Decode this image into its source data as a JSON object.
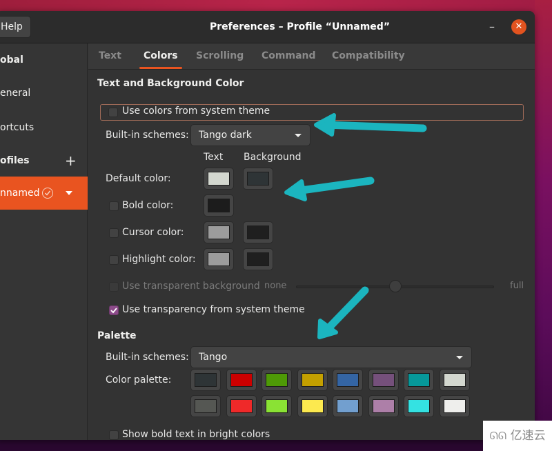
{
  "window": {
    "title": "Preferences – Profile “Unnamed”",
    "help_label": "Help",
    "minimize_glyph": "–",
    "close_glyph": "✕"
  },
  "sidebar": {
    "items": [
      {
        "label": "Global",
        "visible_text": "obal",
        "type": "header"
      },
      {
        "label": "General",
        "visible_text": "eneral",
        "type": "item"
      },
      {
        "label": "Shortcuts",
        "visible_text": "ortcuts",
        "type": "item"
      },
      {
        "label": "Profiles",
        "visible_text": "ofiles",
        "type": "header",
        "action_icon": "+"
      },
      {
        "label": "Unnamed",
        "visible_text": "nnamed",
        "type": "item",
        "selected": true,
        "default": true
      }
    ]
  },
  "tabs": [
    {
      "label": "Text",
      "active": false
    },
    {
      "label": "Colors",
      "active": true
    },
    {
      "label": "Scrolling",
      "active": false
    },
    {
      "label": "Command",
      "active": false
    },
    {
      "label": "Compatibility",
      "active": false
    }
  ],
  "text_bg": {
    "section_title": "Text and Background Color",
    "use_system_colors": {
      "label": "Use colors from system theme",
      "checked": false
    },
    "schemes_label": "Built-in schemes:",
    "scheme_value": "Tango dark",
    "col_text": "Text",
    "col_background": "Background",
    "rows": [
      {
        "label": "Default color:",
        "has_checkbox": false,
        "checked": false,
        "text_color": "#d3d7cf",
        "bg_color": "#2e3436"
      },
      {
        "label": "Bold color:",
        "has_checkbox": true,
        "checked": false,
        "text_color": "#1c1c1c"
      },
      {
        "label": "Cursor color:",
        "has_checkbox": true,
        "checked": false,
        "text_color": "#9c9c9c",
        "bg_color": "#1f1f1f"
      },
      {
        "label": "Highlight color:",
        "has_checkbox": true,
        "checked": false,
        "text_color": "#9c9c9c",
        "bg_color": "#1f1f1f"
      }
    ],
    "transparent_bg": {
      "label": "Use transparent background",
      "checked": false,
      "enabled": false
    },
    "slider": {
      "min_label": "none",
      "max_label": "full",
      "value": 0.5
    },
    "system_transparency": {
      "label": "Use transparency from system theme",
      "checked": true
    }
  },
  "palette": {
    "section_title": "Palette",
    "schemes_label": "Built-in schemes:",
    "scheme_value": "Tango",
    "palette_label": "Color palette:",
    "row1": [
      "#2e3436",
      "#cc0000",
      "#4e9a06",
      "#c4a000",
      "#3465a4",
      "#75507b",
      "#06989a",
      "#d3d7cf"
    ],
    "row2": [
      "#555753",
      "#ef2929",
      "#8ae234",
      "#fce94f",
      "#729fcf",
      "#ad7fa8",
      "#34e2e2",
      "#eeeeec"
    ],
    "bold_bright": {
      "label": "Show bold text in bright colors",
      "checked": false
    }
  },
  "annotations": {
    "arrow_color": "#1bb5bf"
  },
  "watermark": {
    "logo": "ᘏᘏ",
    "text": "亿速云"
  },
  "colors": {
    "accent": "#e95420",
    "checkbox_checked": "#8c4b8a"
  }
}
